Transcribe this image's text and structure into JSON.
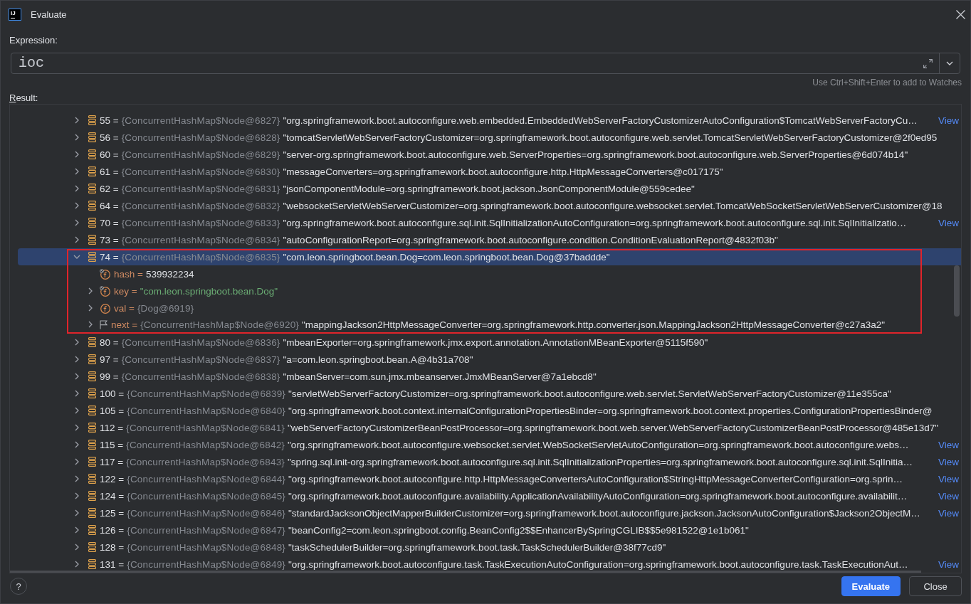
{
  "window": {
    "app_logo": "IJ",
    "title": "Evaluate"
  },
  "expression": {
    "label": "Expression:",
    "value": "ioc",
    "hint": "Use Ctrl+Shift+Enter to add to Watches"
  },
  "result": {
    "label": "Result:",
    "rows": [
      {
        "label": "55 =",
        "type": "{ConcurrentHashMap$Node@6827}",
        "value": "\"org.springframework.boot.autoconfigure.web.embedded.EmbeddedWebServerFactoryCustomizerAutoConfiguration$TomcatWebServerFactoryCu…",
        "link": "View",
        "expanded": false,
        "selected": false,
        "highlighted": false
      },
      {
        "label": "56 =",
        "type": "{ConcurrentHashMap$Node@6828}",
        "value": "\"tomcatServletWebServerFactoryCustomizer=org.springframework.boot.autoconfigure.web.servlet.TomcatServletWebServerFactoryCustomizer@2f0ed95",
        "expanded": false,
        "selected": false,
        "highlighted": false
      },
      {
        "label": "60 =",
        "type": "{ConcurrentHashMap$Node@6829}",
        "value": "\"server-org.springframework.boot.autoconfigure.web.ServerProperties=org.springframework.boot.autoconfigure.web.ServerProperties@6d074b14\"",
        "expanded": false,
        "selected": false,
        "highlighted": false
      },
      {
        "label": "61 =",
        "type": "{ConcurrentHashMap$Node@6830}",
        "value": "\"messageConverters=org.springframework.boot.autoconfigure.http.HttpMessageConverters@c017175\"",
        "expanded": false,
        "selected": false,
        "highlighted": false
      },
      {
        "label": "62 =",
        "type": "{ConcurrentHashMap$Node@6831}",
        "value": "\"jsonComponentModule=org.springframework.boot.jackson.JsonComponentModule@559cedee\"",
        "expanded": false,
        "selected": false,
        "highlighted": false
      },
      {
        "label": "64 =",
        "type": "{ConcurrentHashMap$Node@6832}",
        "value": "\"websocketServletWebServerCustomizer=org.springframework.boot.autoconfigure.websocket.servlet.TomcatWebSocketServletWebServerCustomizer@18",
        "expanded": false,
        "selected": false,
        "highlighted": false
      },
      {
        "label": "70 =",
        "type": "{ConcurrentHashMap$Node@6833}",
        "value": "\"org.springframework.boot.autoconfigure.sql.init.SqlInitializationAutoConfiguration=org.springframework.boot.autoconfigure.sql.init.SqlInitializatio…",
        "link": "View",
        "expanded": false,
        "selected": false,
        "highlighted": false
      },
      {
        "label": "73 =",
        "type": "{ConcurrentHashMap$Node@6834}",
        "value": "\"autoConfigurationReport=org.springframework.boot.autoconfigure.condition.ConditionEvaluationReport@4832f03b\"",
        "expanded": false,
        "selected": false,
        "highlighted": false
      },
      {
        "label": "74 =",
        "type": "{ConcurrentHashMap$Node@6835}",
        "value": "\"com.leon.springboot.bean.Dog=com.leon.springboot.bean.Dog@37baddde\"",
        "expanded": true,
        "selected": true,
        "highlighted": true,
        "children": [
          {
            "label": "hash =",
            "kind": "locked",
            "expandable": false,
            "selected": false,
            "number": "539932234"
          },
          {
            "label": "key =",
            "kind": "locked",
            "expandable": true,
            "selected": false,
            "string": "\"com.leon.springboot.bean.Dog\""
          },
          {
            "label": "val =",
            "kind": "field",
            "expandable": true,
            "selected": false,
            "type": "{Dog@6919}"
          },
          {
            "label": "next =",
            "kind": "flag",
            "expandable": true,
            "selected": false,
            "type": "{ConcurrentHashMap$Node@6920}",
            "value": "\"mappingJackson2HttpMessageConverter=org.springframework.http.converter.json.MappingJackson2HttpMessageConverter@c27a3a2\""
          }
        ]
      },
      {
        "label": "80 =",
        "type": "{ConcurrentHashMap$Node@6836}",
        "value": "\"mbeanExporter=org.springframework.jmx.export.annotation.AnnotationMBeanExporter@5115f590\"",
        "expanded": false,
        "selected": false,
        "highlighted": false
      },
      {
        "label": "97 =",
        "type": "{ConcurrentHashMap$Node@6837}",
        "value": "\"a=com.leon.springboot.bean.A@4b31a708\"",
        "expanded": false,
        "selected": false,
        "highlighted": false
      },
      {
        "label": "99 =",
        "type": "{ConcurrentHashMap$Node@6838}",
        "value": "\"mbeanServer=com.sun.jmx.mbeanserver.JmxMBeanServer@7a1ebcd8\"",
        "expanded": false,
        "selected": false,
        "highlighted": false
      },
      {
        "label": "100 =",
        "type": "{ConcurrentHashMap$Node@6839}",
        "value": "\"servletWebServerFactoryCustomizer=org.springframework.boot.autoconfigure.web.servlet.ServletWebServerFactoryCustomizer@11e355ca\"",
        "expanded": false,
        "selected": false,
        "highlighted": false
      },
      {
        "label": "105 =",
        "type": "{ConcurrentHashMap$Node@6840}",
        "value": "\"org.springframework.boot.context.internalConfigurationPropertiesBinder=org.springframework.boot.context.properties.ConfigurationPropertiesBinder@",
        "expanded": false,
        "selected": false,
        "highlighted": false
      },
      {
        "label": "112 =",
        "type": "{ConcurrentHashMap$Node@6841}",
        "value": "\"webServerFactoryCustomizerBeanPostProcessor=org.springframework.boot.web.server.WebServerFactoryCustomizerBeanPostProcessor@485e13d7\"",
        "expanded": false,
        "selected": false,
        "highlighted": false
      },
      {
        "label": "115 =",
        "type": "{ConcurrentHashMap$Node@6842}",
        "value": "\"org.springframework.boot.autoconfigure.websocket.servlet.WebSocketServletAutoConfiguration=org.springframework.boot.autoconfigure.webs…",
        "link": "View",
        "expanded": false,
        "selected": false,
        "highlighted": false
      },
      {
        "label": "117 =",
        "type": "{ConcurrentHashMap$Node@6843}",
        "value": "\"spring.sql.init-org.springframework.boot.autoconfigure.sql.init.SqlInitializationProperties=org.springframework.boot.autoconfigure.sql.init.SqlInitia…",
        "link": "View",
        "expanded": false,
        "selected": false,
        "highlighted": false
      },
      {
        "label": "122 =",
        "type": "{ConcurrentHashMap$Node@6844}",
        "value": "\"org.springframework.boot.autoconfigure.http.HttpMessageConvertersAutoConfiguration$StringHttpMessageConverterConfiguration=org.sprin…",
        "link": "View",
        "expanded": false,
        "selected": false,
        "highlighted": false
      },
      {
        "label": "124 =",
        "type": "{ConcurrentHashMap$Node@6845}",
        "value": "\"org.springframework.boot.autoconfigure.availability.ApplicationAvailabilityAutoConfiguration=org.springframework.boot.autoconfigure.availabilit…",
        "link": "View",
        "expanded": false,
        "selected": false,
        "highlighted": false
      },
      {
        "label": "125 =",
        "type": "{ConcurrentHashMap$Node@6846}",
        "value": "\"standardJacksonObjectMapperBuilderCustomizer=org.springframework.boot.autoconfigure.jackson.JacksonAutoConfiguration$Jackson2ObjectM…",
        "link": "View",
        "expanded": false,
        "selected": false,
        "highlighted": false
      },
      {
        "label": "126 =",
        "type": "{ConcurrentHashMap$Node@6847}",
        "value": "\"beanConfig2=com.leon.springboot.config.BeanConfig2$$EnhancerBySpringCGLIB$$5e981522@1e1b061\"",
        "expanded": false,
        "selected": false,
        "highlighted": false
      },
      {
        "label": "128 =",
        "type": "{ConcurrentHashMap$Node@6848}",
        "value": "\"taskSchedulerBuilder=org.springframework.boot.task.TaskSchedulerBuilder@38f77cd9\"",
        "expanded": false,
        "selected": false,
        "highlighted": false
      },
      {
        "label": "131 =",
        "type": "{ConcurrentHashMap$Node@6849}",
        "value": "\"org.springframework.boot.autoconfigure.task.TaskExecutionAutoConfiguration=org.springframework.boot.autoconfigure.task.TaskExecutionAut…",
        "link": "View",
        "expanded": false,
        "selected": false,
        "highlighted": false
      }
    ]
  },
  "footer": {
    "help": "?",
    "buttons": [
      {
        "label": "Evaluate",
        "primary": true
      },
      {
        "label": "Close",
        "primary": false
      }
    ]
  }
}
